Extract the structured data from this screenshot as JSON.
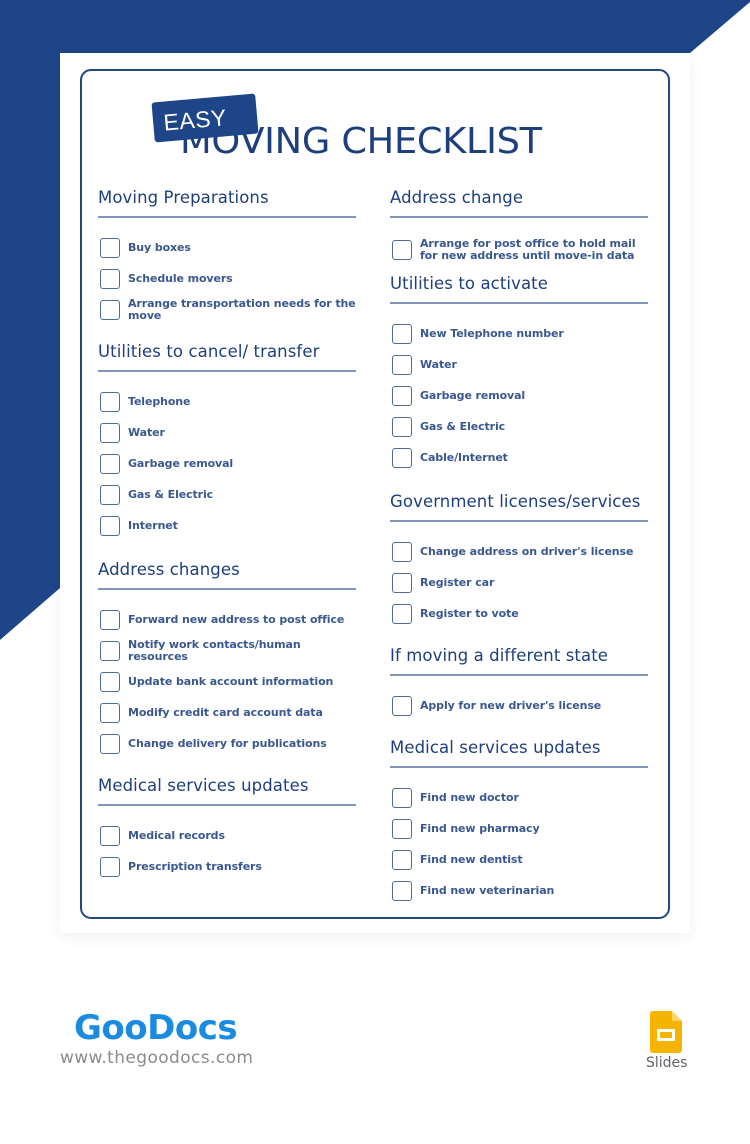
{
  "document": {
    "badge": "EASY",
    "title": "MOVING CHECKLIST",
    "colors": {
      "primary": "#1e4587",
      "text": "#1e3f7d",
      "rule": "#7f95bb",
      "logo": "#1a8be0",
      "slides": "#f4b400"
    },
    "left_column": [
      {
        "title": "Moving Preparations",
        "items": [
          "Buy boxes",
          "Schedule movers",
          "Arrange transportation needs for the move"
        ]
      },
      {
        "title": "Utilities to cancel/ transfer",
        "items": [
          "Telephone",
          "Water",
          "Garbage removal",
          "Gas & Electric",
          "Internet"
        ]
      },
      {
        "title": "Address changes",
        "items": [
          "Forward new address to post office",
          "Notify work contacts/human resources",
          "Update bank account information",
          "Modify credit card account data",
          "Change delivery for publications"
        ]
      },
      {
        "title": "Medical services updates",
        "items": [
          "Medical records",
          "Prescription transfers"
        ]
      }
    ],
    "right_column": [
      {
        "title": "Address change",
        "items": [
          "Arrange for post office to hold mail for new address until move-in data"
        ]
      },
      {
        "title": "Utilities to activate",
        "items": [
          "New Telephone number",
          "Water",
          "Garbage removal",
          "Gas & Electric",
          "Cable/Internet"
        ]
      },
      {
        "title": "Government licenses/services",
        "items": [
          "Change address on driver's license",
          "Register car",
          "Register to vote"
        ]
      },
      {
        "title": "If moving a different state",
        "items": [
          "Apply for new driver's license"
        ]
      },
      {
        "title": "Medical services updates",
        "items": [
          "Find new doctor",
          "Find new pharmacy",
          "Find new dentist",
          "Find new veterinarian"
        ]
      }
    ]
  },
  "footer": {
    "logo_part1": "Goo",
    "logo_part2": "Docs",
    "url": "www.thegoodocs.com",
    "app_icon": "google-slides-icon",
    "app_label": "Slides"
  }
}
